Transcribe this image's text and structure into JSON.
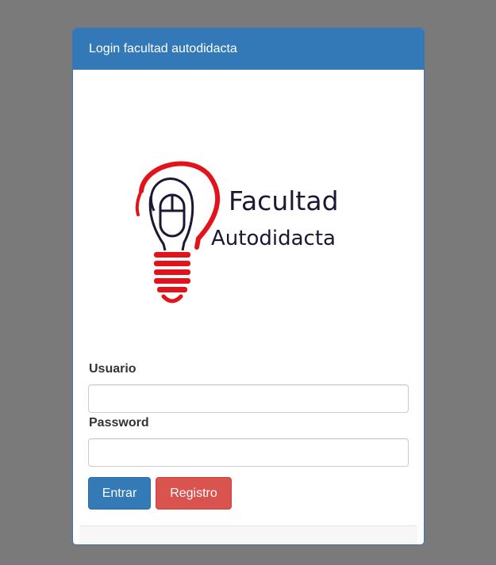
{
  "panel": {
    "title": "Login facultad autodidacta"
  },
  "logo": {
    "line1": "Facultad",
    "line2": "Autodidacta",
    "icon": "lightbulb-mouse-icon"
  },
  "form": {
    "username_label": "Usuario",
    "username_value": "",
    "username_placeholder": "",
    "password_label": "Password",
    "password_value": "",
    "password_placeholder": "",
    "submit_label": "Entrar",
    "register_label": "Registro"
  },
  "colors": {
    "primary": "#337ab7",
    "danger": "#d9534f",
    "backdrop": "#7a7a7a",
    "logo_red": "#e3131b",
    "logo_dark": "#1b1834"
  }
}
